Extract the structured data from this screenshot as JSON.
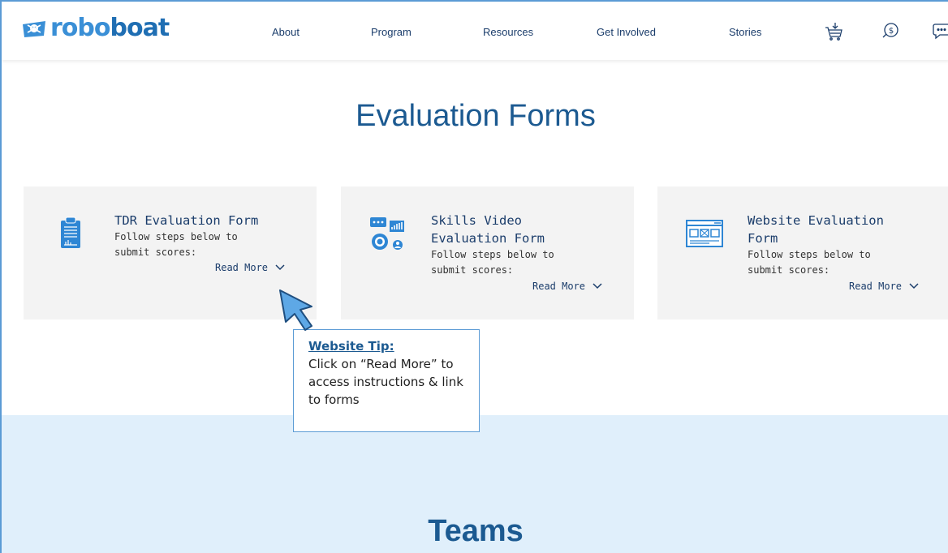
{
  "header": {
    "logo_text_left": "robo",
    "logo_text_right": "boat",
    "nav": [
      "About",
      "Program",
      "Resources",
      "Get Involved",
      "Stories"
    ],
    "icons": [
      "shopping-cart-icon",
      "donate-coin-icon",
      "chat-bubble-icon"
    ]
  },
  "page": {
    "title": "Evaluation Forms",
    "section_title": "Teams"
  },
  "cards": [
    {
      "icon": "clipboard-report-icon",
      "title_lines": [
        "TDR Evaluation Form"
      ],
      "desc_lines": [
        "Follow steps below to",
        "submit scores:"
      ],
      "read_more": "Read More"
    },
    {
      "icon": "video-skills-gears-icon",
      "title_lines": [
        "Skills Video",
        "Evaluation Form"
      ],
      "desc_lines": [
        "Follow steps below to",
        "submit scores:"
      ],
      "read_more": "Read More"
    },
    {
      "icon": "website-browser-icon",
      "title_lines": [
        "Website Evaluation",
        "Form"
      ],
      "desc_lines": [
        "Follow steps below to",
        "submit scores:"
      ],
      "read_more": "Read More"
    }
  ],
  "tip": {
    "heading": "Website Tip:",
    "body": "Click on “Read More” to access instructions & link to forms"
  },
  "colors": {
    "brand_blue": "#3a8fd6",
    "heading_blue": "#1c5a91",
    "callout_border": "#5b9bd5",
    "card_bg": "#f3f3f3",
    "band_bg": "#e0effb"
  }
}
